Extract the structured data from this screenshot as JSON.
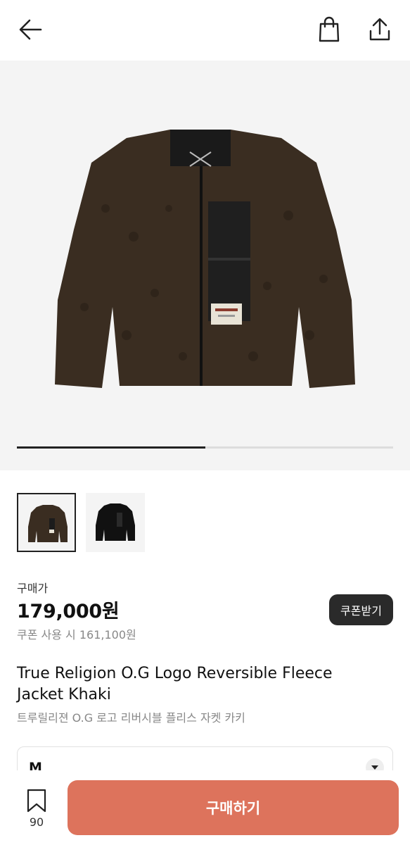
{
  "header": {
    "back_icon": "arrow-left-icon",
    "bag_icon": "shopping-bag-icon",
    "share_icon": "share-icon"
  },
  "gallery": {
    "progress": 0.5,
    "thumbnails": [
      {
        "color": "#3a2d21",
        "selected": true
      },
      {
        "color": "#111111",
        "selected": false
      }
    ]
  },
  "pricing": {
    "label": "구매가",
    "price": "179,000원",
    "coupon_price": "쿠폰 사용 시 161,100원",
    "coupon_button": "쿠폰받기"
  },
  "product": {
    "title_en": "True Religion O.G Logo Reversible Fleece Jacket Khaki",
    "title_ko": "트루릴리젼 O.G 로고 리버시블 플리스 자켓 카키"
  },
  "option": {
    "selected": "M"
  },
  "bottom": {
    "wish_count": "90",
    "buy_label": "구매하기"
  },
  "colors": {
    "accent": "#dd735c",
    "dark": "#2a2a2a"
  }
}
